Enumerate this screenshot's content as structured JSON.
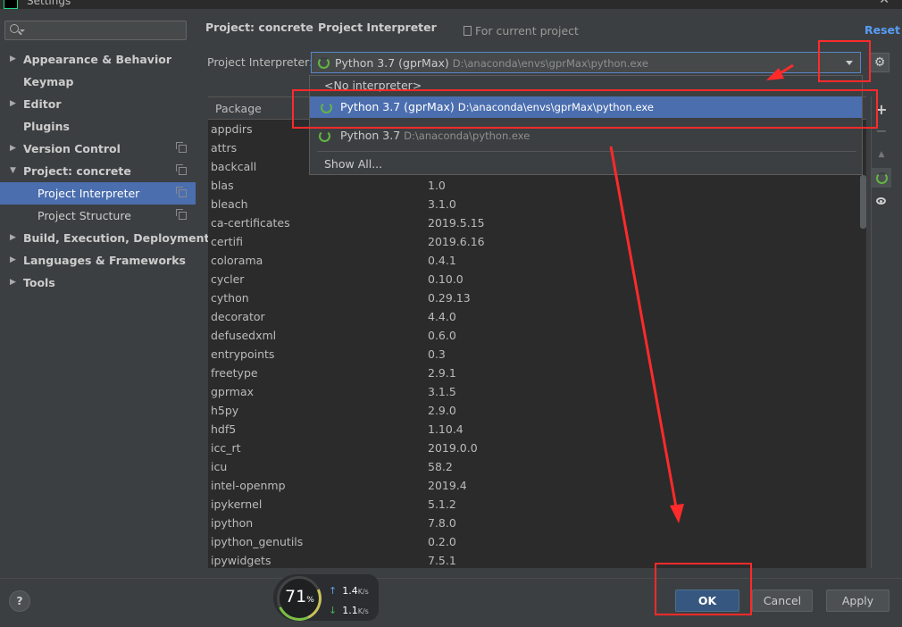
{
  "window": {
    "title": "Settings"
  },
  "sidebar": {
    "items": [
      {
        "label": "Appearance & Behavior",
        "expand": "▶",
        "level": 0,
        "copy": false
      },
      {
        "label": "Keymap",
        "expand": "",
        "level": 0,
        "copy": false
      },
      {
        "label": "Editor",
        "expand": "▶",
        "level": 0,
        "copy": false
      },
      {
        "label": "Plugins",
        "expand": "",
        "level": 0,
        "copy": false
      },
      {
        "label": "Version Control",
        "expand": "▶",
        "level": 0,
        "copy": true
      },
      {
        "label": "Project: concrete",
        "expand": "▼",
        "level": 0,
        "copy": true
      },
      {
        "label": "Project Interpreter",
        "expand": "",
        "level": 1,
        "copy": true,
        "selected": true
      },
      {
        "label": "Project Structure",
        "expand": "",
        "level": 1,
        "copy": true
      },
      {
        "label": "Build, Execution, Deployment",
        "expand": "▶",
        "level": 0,
        "copy": false
      },
      {
        "label": "Languages & Frameworks",
        "expand": "▶",
        "level": 0,
        "copy": false
      },
      {
        "label": "Tools",
        "expand": "▶",
        "level": 0,
        "copy": false
      }
    ]
  },
  "header": {
    "crumb_project": "Project: concrete",
    "crumb_separator": "›",
    "crumb_page": "Project Interpreter",
    "scope_note": "For current project",
    "reset_label": "Reset"
  },
  "interpreter": {
    "label": "Project Interpreter:",
    "selected_name": "Python 3.7 (gprMax)",
    "selected_path": "D:\\anaconda\\envs\\gprMax\\python.exe",
    "gear_glyph": "⚙"
  },
  "dropdown": {
    "no_interpreter": "<No interpreter>",
    "options": [
      {
        "name": "Python 3.7 (gprMax)",
        "path": "D:\\anaconda\\envs\\gprMax\\python.exe"
      },
      {
        "name": "Python 3.7",
        "path": "D:\\anaconda\\python.exe"
      }
    ],
    "show_all": "Show All..."
  },
  "table": {
    "headers": [
      "Package"
    ],
    "rows": [
      {
        "name": "appdirs",
        "version": ""
      },
      {
        "name": "attrs",
        "version": ""
      },
      {
        "name": "backcall",
        "version": ""
      },
      {
        "name": "blas",
        "version": "1.0"
      },
      {
        "name": "bleach",
        "version": "3.1.0"
      },
      {
        "name": "ca-certificates",
        "version": "2019.5.15"
      },
      {
        "name": "certifi",
        "version": "2019.6.16"
      },
      {
        "name": "colorama",
        "version": "0.4.1"
      },
      {
        "name": "cycler",
        "version": "0.10.0"
      },
      {
        "name": "cython",
        "version": "0.29.13"
      },
      {
        "name": "decorator",
        "version": "4.4.0"
      },
      {
        "name": "defusedxml",
        "version": "0.6.0"
      },
      {
        "name": "entrypoints",
        "version": "0.3"
      },
      {
        "name": "freetype",
        "version": "2.9.1"
      },
      {
        "name": "gprmax",
        "version": "3.1.5"
      },
      {
        "name": "h5py",
        "version": "2.9.0"
      },
      {
        "name": "hdf5",
        "version": "1.10.4"
      },
      {
        "name": "icc_rt",
        "version": "2019.0.0"
      },
      {
        "name": "icu",
        "version": "58.2"
      },
      {
        "name": "intel-openmp",
        "version": "2019.4"
      },
      {
        "name": "ipykernel",
        "version": "5.1.2"
      },
      {
        "name": "ipython",
        "version": "7.8.0"
      },
      {
        "name": "ipython_genutils",
        "version": "0.2.0"
      },
      {
        "name": "ipywidgets",
        "version": "7.5.1"
      }
    ]
  },
  "toolbar": {
    "add": "+",
    "remove": "−",
    "up": "▲"
  },
  "footer": {
    "help": "?",
    "ok": "OK",
    "cancel": "Cancel",
    "apply": "Apply"
  },
  "network": {
    "percent": "71",
    "percent_unit": "%",
    "up": "1.4",
    "down": "1.1",
    "unit": "K/s"
  },
  "colors": {
    "background": "#3c3f41",
    "selection": "#4b6eaf",
    "annotation": "#ff2a2a",
    "accent_link": "#589df6"
  }
}
